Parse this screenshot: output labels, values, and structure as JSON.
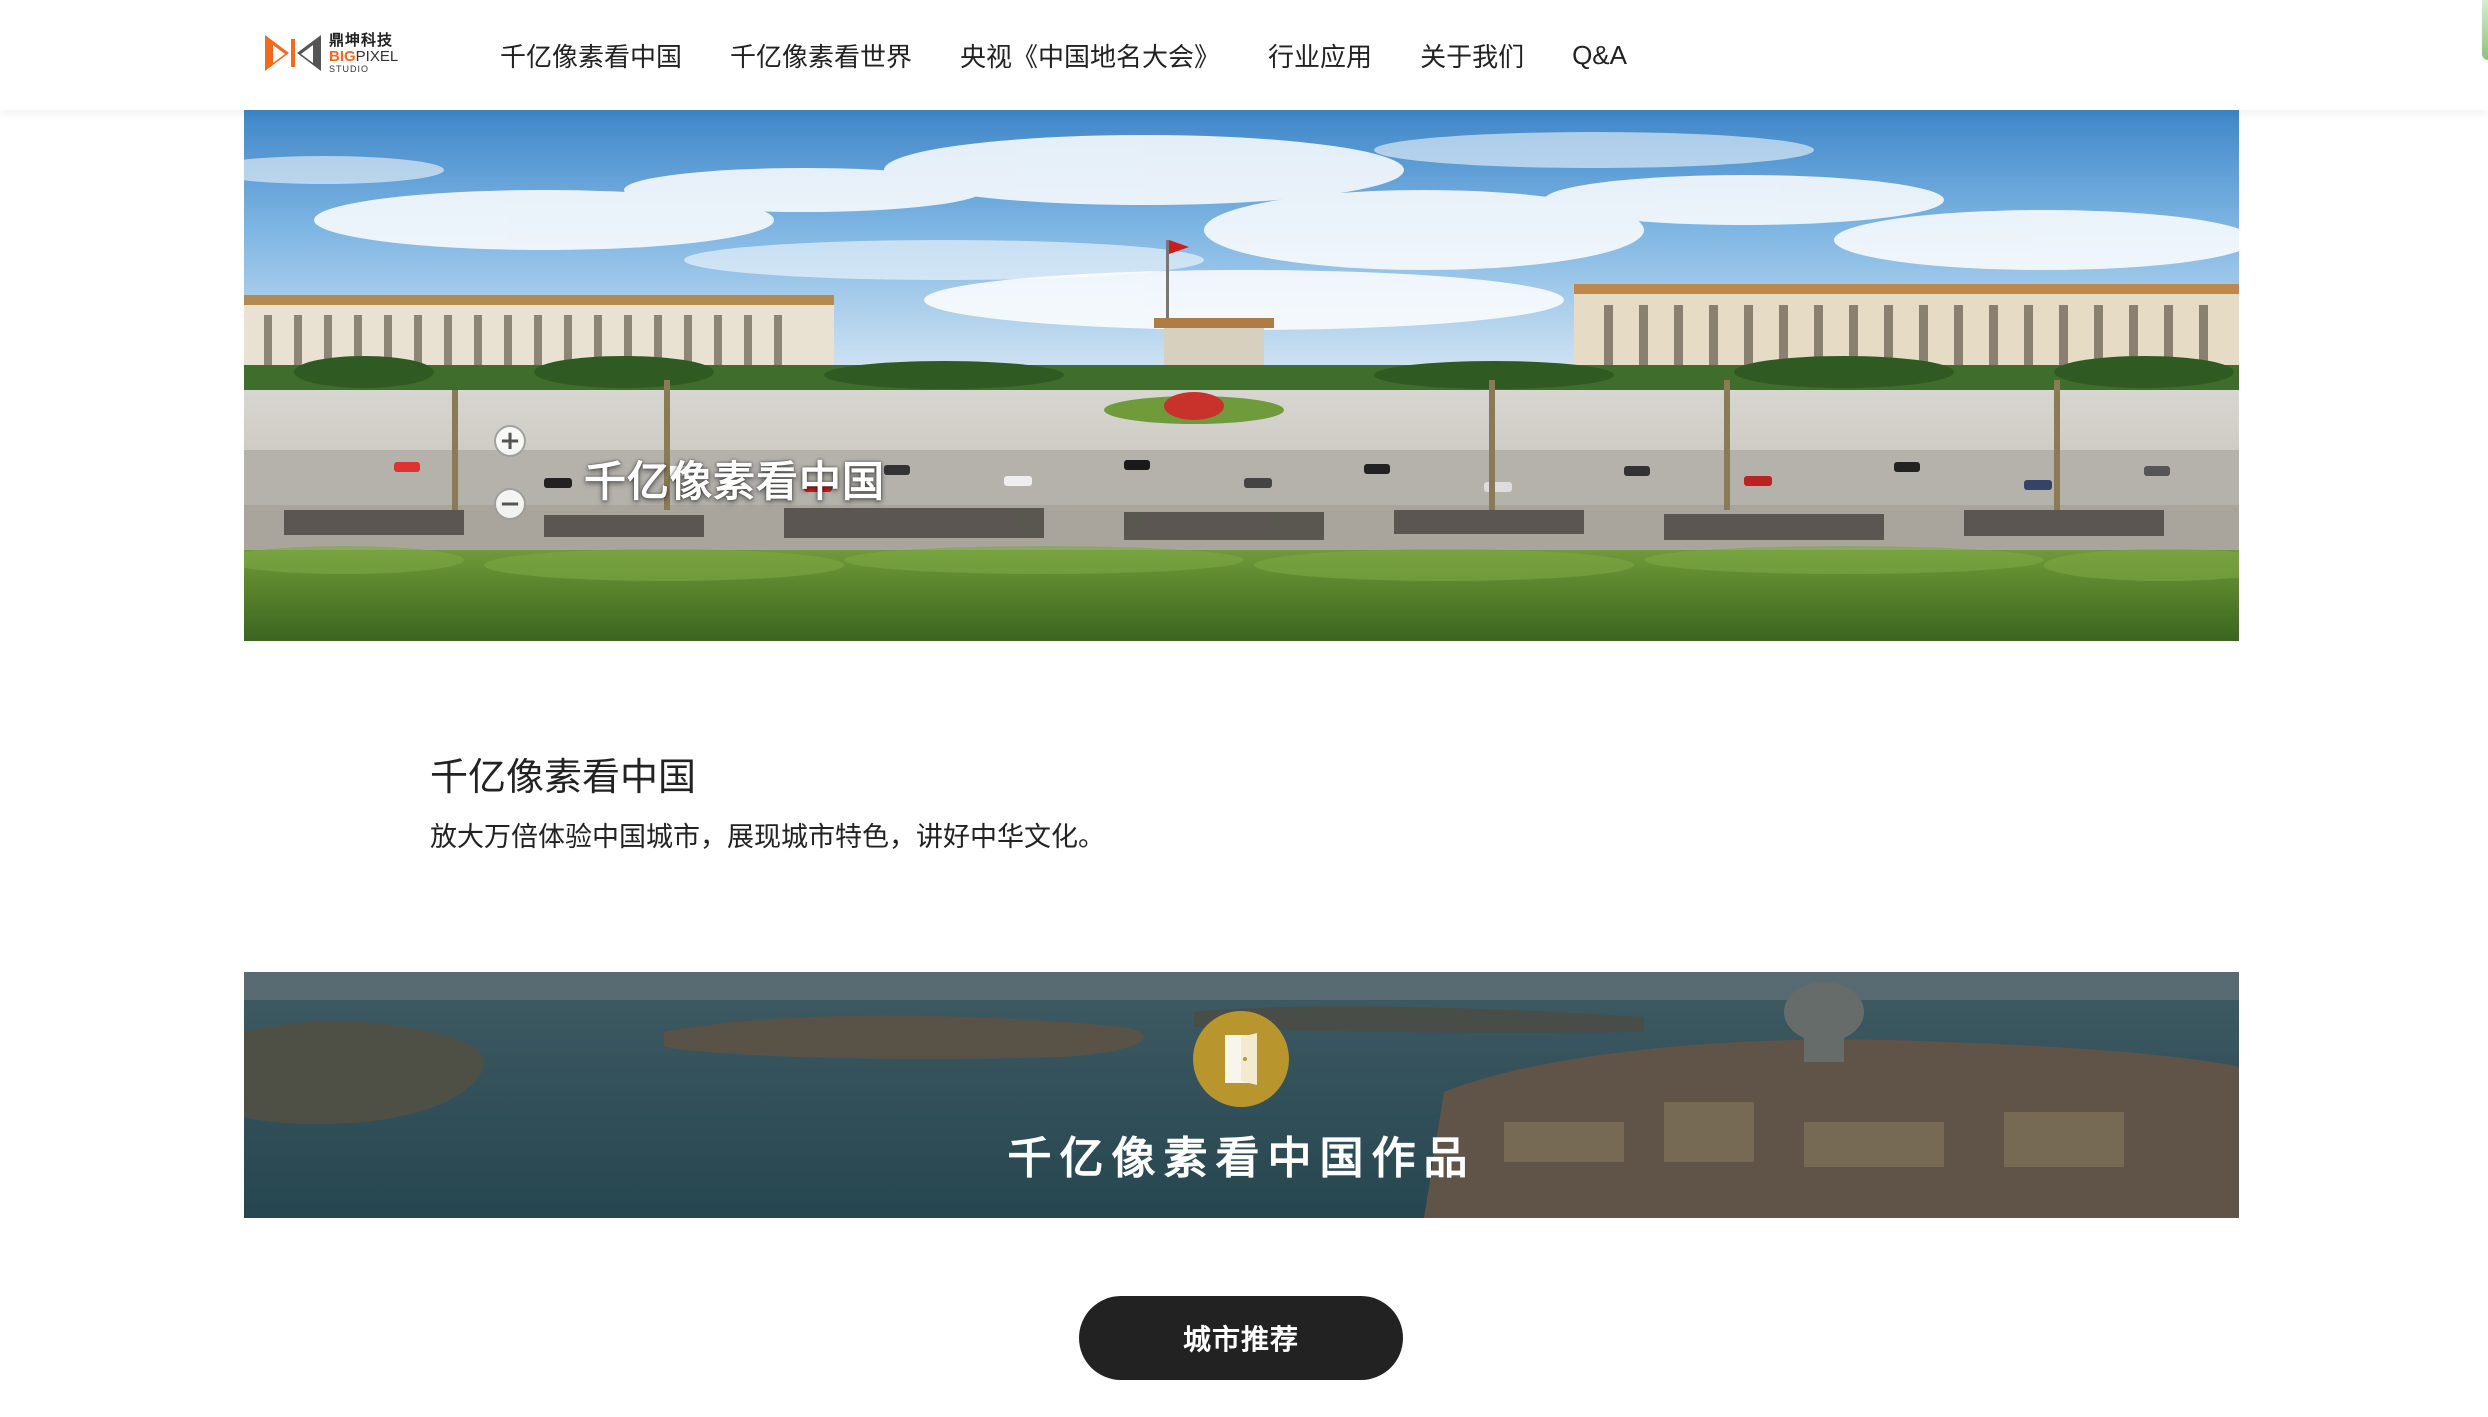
{
  "brand": {
    "name_cn": "鼎坤科技",
    "name_en_big": "BIG",
    "name_en_pixel": "PIXEL",
    "name_en_studio": "STUDIO",
    "logo_icon": "bigpixel-logo-icon",
    "colors": {
      "orange": "#f26b1d",
      "dark": "#222222"
    }
  },
  "nav": {
    "items": [
      {
        "label": "千亿像素看中国"
      },
      {
        "label": "千亿像素看世界"
      },
      {
        "label": "央视《中国地名大会》"
      },
      {
        "label": "行业应用"
      },
      {
        "label": "关于我们"
      },
      {
        "label": "Q&A"
      }
    ]
  },
  "hero": {
    "title": "千亿像素看中国",
    "zoom_in_icon": "plus-icon",
    "zoom_out_icon": "minus-icon"
  },
  "intro": {
    "title": "千亿像素看中国",
    "description": "放大万倍体验中国城市，展现城市特色，讲好中华文化。"
  },
  "works_banner": {
    "title": "千亿像素看中国作品",
    "icon": "door-icon",
    "icon_color": "#b8952d"
  },
  "city_button": {
    "label": "城市推荐"
  }
}
